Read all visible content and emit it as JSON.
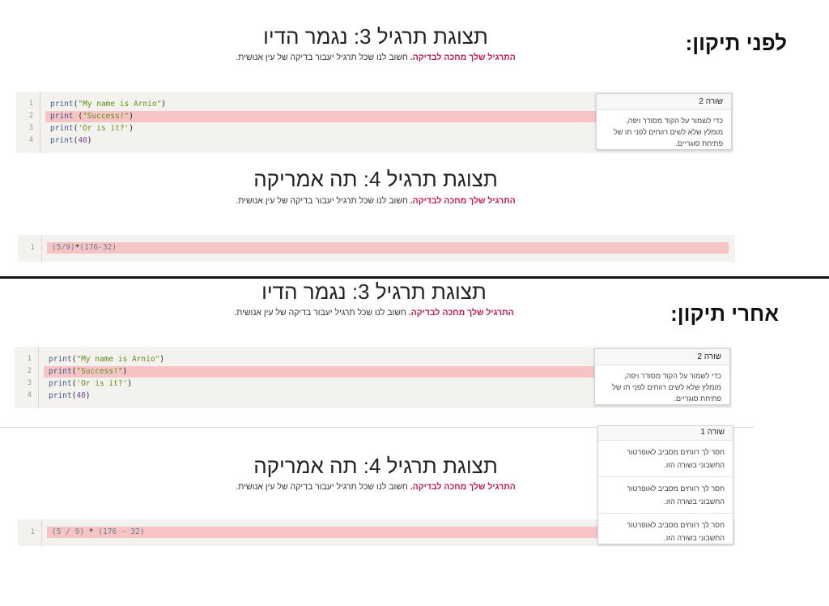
{
  "before": {
    "label": "לפני תיקון:",
    "ex3": {
      "title": "תצוגת תרגיל 3: נגמר הדיו",
      "sub_bold": "התרגיל שלך מחכה לבדיקה.",
      "sub_rest": " חשוב לנו שכל תרגיל יעבור בדיקה של עין אנושית.",
      "lines": [
        "1",
        "2",
        "3",
        "4"
      ],
      "code": {
        "l1_fn": "print",
        "l1_open": "(",
        "l1_str": "\"My name is Arnio\"",
        "l1_close": ")",
        "l2_fn": "print",
        "l2_open": " (",
        "l2_str": "\"Success!\"",
        "l2_close": ")",
        "l3_fn": "print",
        "l3_open": "(",
        "l3_str": "'Or is it?'",
        "l3_close": ")",
        "l4_fn": "print",
        "l4_open": "(",
        "l4_num": "40",
        "l4_close": ")"
      },
      "tip": {
        "head": "שורה 2",
        "body": "כדי לשמור על הקוד מסודר ויפה, מומלץ שלא לשים רווחים לפני תו של פתיחת סוגריים."
      }
    },
    "ex4": {
      "title": "תצוגת תרגיל 4: תה אמריקה",
      "sub_bold": "התרגיל שלך מחכה לבדיקה.",
      "sub_rest": " חשוב לנו שכל תרגיל יעבור בדיקה של עין אנושית.",
      "lines": [
        "1"
      ],
      "code": {
        "a": "(5/9)",
        "b": "*",
        "c": "(176-32)"
      }
    }
  },
  "after": {
    "label": "אחרי תיקון:",
    "ex3": {
      "title": "תצוגת תרגיל 3: נגמר הדיו",
      "sub_bold": "התרגיל שלך מחכה לבדיקה.",
      "sub_rest": " חשוב לנו שכל תרגיל יעבור בדיקה של עין אנושית.",
      "lines": [
        "1",
        "2",
        "3",
        "4"
      ],
      "code": {
        "l1_fn": "print",
        "l1_open": "(",
        "l1_str": "\"My name is Arnio\"",
        "l1_close": ")",
        "l2_fn": "print",
        "l2_open": "(",
        "l2_str": "\"Success!\"",
        "l2_close": ")",
        "l3_fn": "print",
        "l3_open": "(",
        "l3_str": "'Or is it?'",
        "l3_close": ")",
        "l4_fn": "print",
        "l4_open": "(",
        "l4_num": "40",
        "l4_close": ")"
      },
      "tip": {
        "head": "שורה 2",
        "body": "כדי לשמור על הקוד מסודר ויפה, מומלץ שלא לשים רווחים לפני תו של פתיחת סוגריים."
      }
    },
    "ex4": {
      "title": "תצוגת תרגיל 4: תה אמריקה",
      "sub_bold": "התרגיל שלך מחכה לבדיקה.",
      "sub_rest": " חשוב לנו שכל תרגיל יעבור בדיקה של עין אנושית.",
      "lines": [
        "1"
      ],
      "code": {
        "a": "(5 / 9)",
        "b": "*",
        "c": "(176 - 32)"
      },
      "tip": {
        "head": "שורה 1",
        "items": [
          "חסר לך רווחים מסביב לאופרטור החשבוני בשורה הזו.",
          "חסר לך רווחים מסביב לאופרטור החשבוני בשורה הזו.",
          "חסר לך רווחים מסביב לאופרטור החשבוני בשורה הזו."
        ]
      }
    }
  }
}
